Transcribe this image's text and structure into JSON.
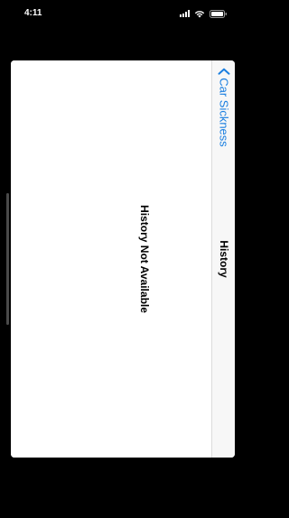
{
  "status_bar": {
    "time": "4:11",
    "icons": [
      "signal-icon",
      "wifi-icon",
      "battery-icon"
    ]
  },
  "nav": {
    "back_label": "Car Sickness",
    "title": "History"
  },
  "content": {
    "empty_message": "History Not Available"
  },
  "colors": {
    "accent": "#1b7fe0",
    "background": "#000000",
    "sheet": "#ffffff",
    "nav_bar": "#f7f7f7"
  }
}
